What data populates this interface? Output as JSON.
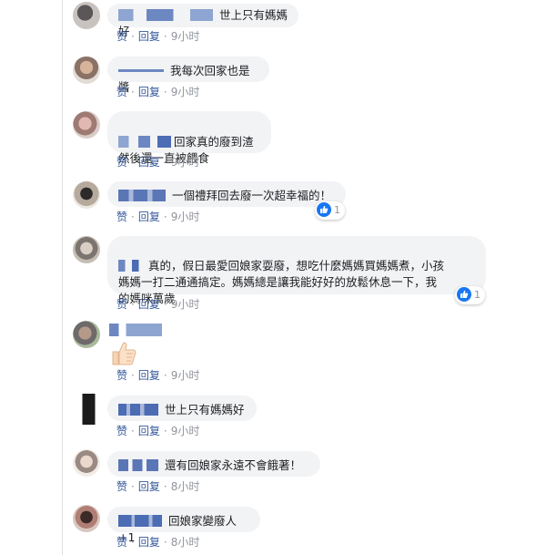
{
  "actions": {
    "like": "赞",
    "reply": "回复",
    "dot": "·"
  },
  "comments": [
    {
      "text": "世上只有媽媽好",
      "time": "9小时"
    },
    {
      "text": "我每次回家也是醬",
      "time": "9小时"
    },
    {
      "text": "回家真的廢到渣\n然後還一直被餵食",
      "time": "9小时"
    },
    {
      "text": "一個禮拜回去廢一次超幸福的！",
      "time": "9小时",
      "reactions": "1"
    },
    {
      "text": "真的，假日最愛回娘家耍廢，想吃什麼媽媽買媽媽煮，小孩\n媽媽一打二通通搞定。媽媽總是讓我能好好的放鬆休息一下，我\n的媽咪萬歲",
      "time": "9小时",
      "reactions": "1"
    },
    {
      "text": "",
      "time": "9小时",
      "sticker": "thumbs-up"
    },
    {
      "text": "世上只有媽媽好",
      "time": "9小时"
    },
    {
      "text": "還有回娘家永遠不會餓著！",
      "time": "8小时"
    },
    {
      "text": "回娘家變廢人+1",
      "time": "8小时"
    }
  ],
  "colors": {
    "link": "#365899",
    "bubble": "#f2f3f5",
    "like_blue": "#1877f2"
  }
}
